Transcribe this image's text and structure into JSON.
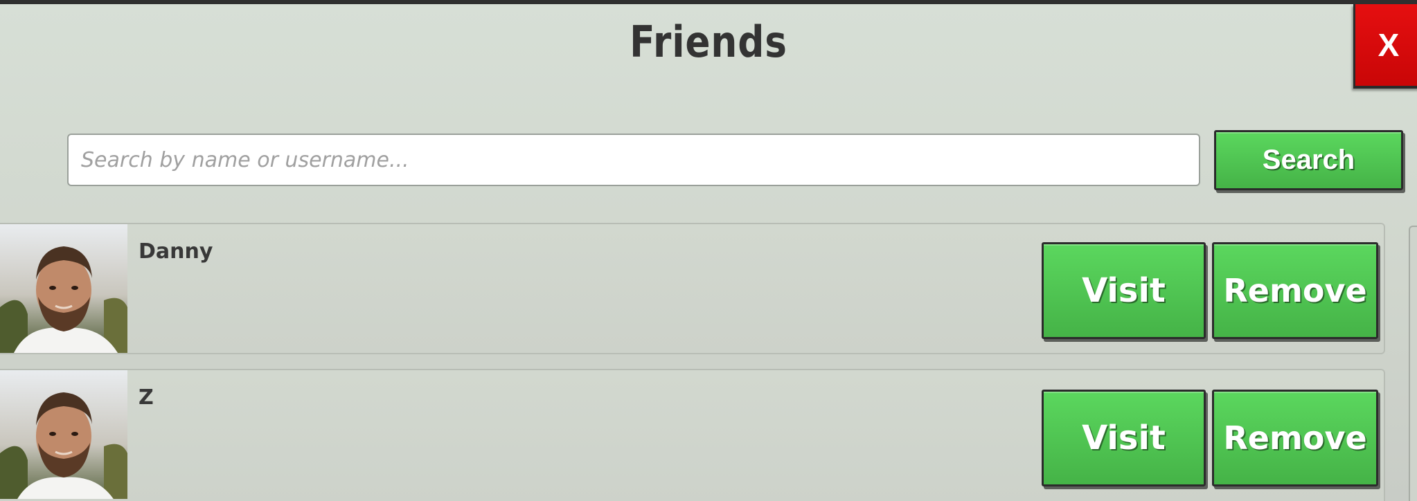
{
  "header": {
    "title": "Friends",
    "close_label": "X"
  },
  "search": {
    "placeholder": "Search by name or username...",
    "value": "",
    "button_label": "Search"
  },
  "friends": [
    {
      "name": "Danny",
      "visit_label": "Visit",
      "remove_label": "Remove"
    },
    {
      "name": "Z",
      "visit_label": "Visit",
      "remove_label": "Remove"
    }
  ],
  "colors": {
    "accent_green": "#52c954",
    "close_red": "#d80a0b",
    "panel": "#d3dad1",
    "text_dark": "#333333"
  }
}
